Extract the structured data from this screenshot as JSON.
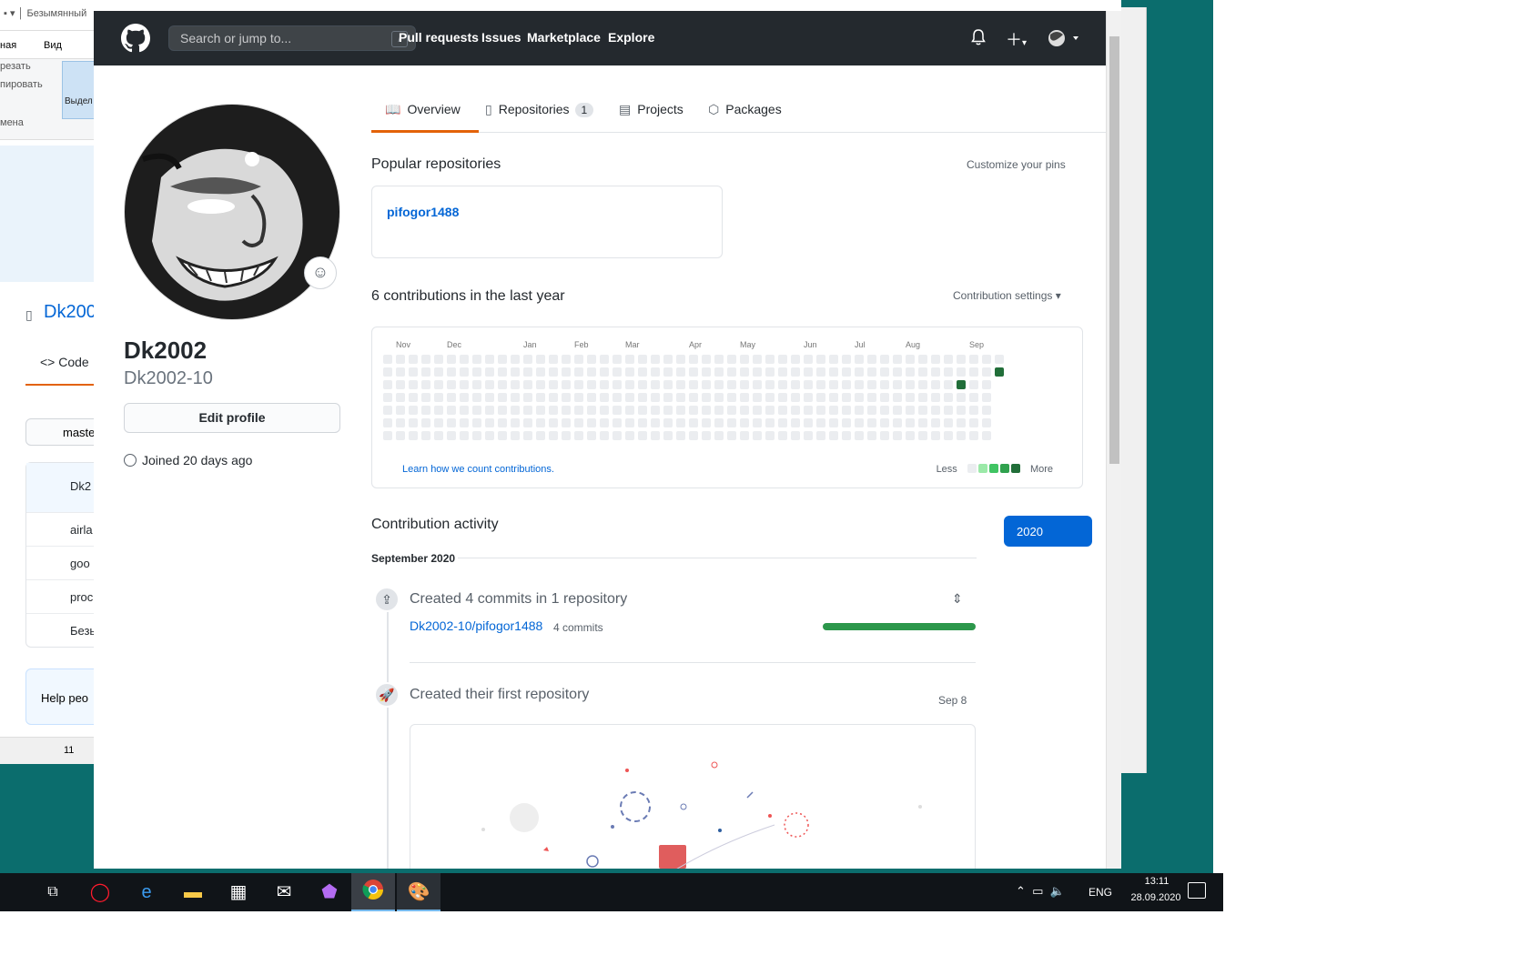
{
  "paint": {
    "title": "Безымянный",
    "tabs": [
      "ная",
      "Вид"
    ],
    "ribbon": [
      "резать",
      "пировать",
      "мена"
    ],
    "select_label": "Выдел",
    "status": "11"
  },
  "bg_github": {
    "repo_name": "Dk200",
    "code_tab": "Code",
    "branch": "maste",
    "files": [
      "Dk2",
      "airla",
      "goo",
      "proc",
      "Безы"
    ],
    "help": "Help peo"
  },
  "header": {
    "search_placeholder": "Search or jump to...",
    "search_shortcut": "/",
    "nav": [
      "Pull requests",
      "Issues",
      "Marketplace",
      "Explore"
    ]
  },
  "profile": {
    "name": "Dk2002",
    "login": "Dk2002-10",
    "edit_button": "Edit profile",
    "joined": "Joined 20 days ago"
  },
  "tabs": {
    "overview": "Overview",
    "repositories": "Repositories",
    "repositories_count": "1",
    "projects": "Projects",
    "packages": "Packages"
  },
  "popular": {
    "title": "Popular repositories",
    "customize": "Customize your pins",
    "repos": [
      "pifogor1488"
    ]
  },
  "contributions": {
    "title": "6 contributions in the last year",
    "settings": "Contribution settings",
    "months": [
      "Nov",
      "Dec",
      "Jan",
      "Feb",
      "Mar",
      "Apr",
      "May",
      "Jun",
      "Jul",
      "Aug",
      "Sep"
    ],
    "learn_link": "Learn how we count contributions.",
    "legend_less": "Less",
    "legend_more": "More",
    "levels": [
      "#ebedf0",
      "#9be9a8",
      "#40c463",
      "#30a14e",
      "#216e39"
    ]
  },
  "activity": {
    "title": "Contribution activity",
    "year": "2020",
    "month": "September 2020",
    "commits_title": "Created 4 commits in 1 repository",
    "commits_repo": "Dk2002-10/pifogor1488",
    "commits_count": "4 commits",
    "first_repo_title": "Created their first repository",
    "first_repo_date": "Sep 8"
  },
  "taskbar": {
    "lang": "ENG",
    "time": "13:11",
    "date": "28.09.2020"
  }
}
